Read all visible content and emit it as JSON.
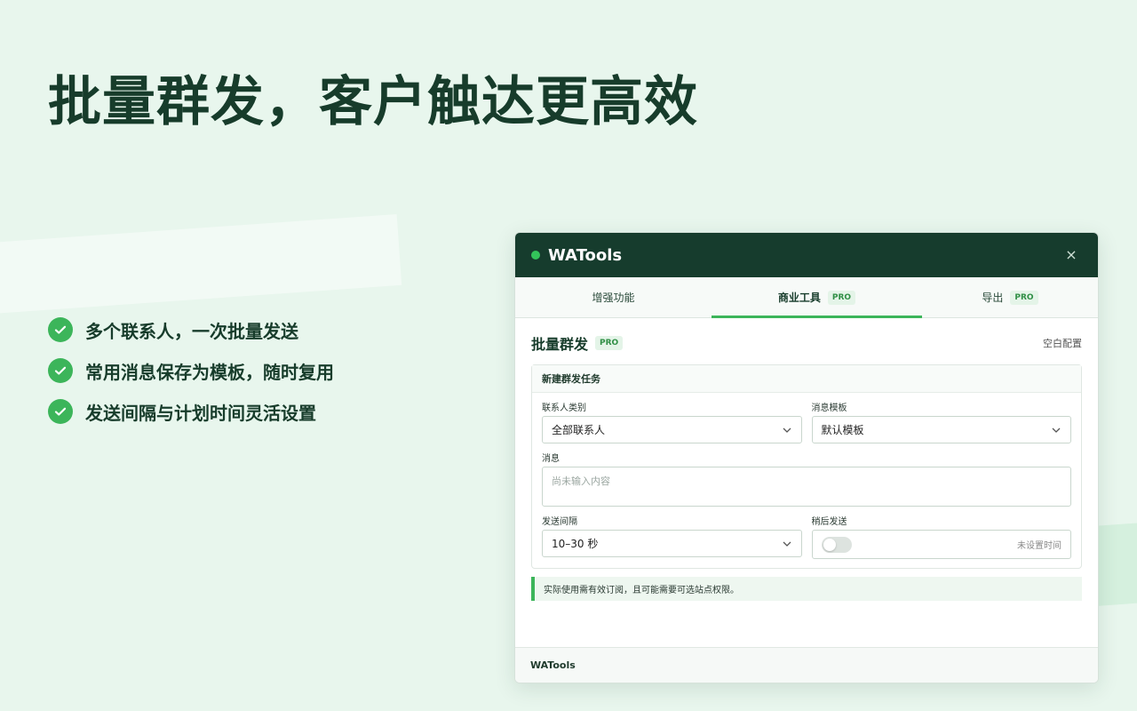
{
  "hero": {
    "title": "批量群发，客户触达更高效"
  },
  "features": [
    "多个联系人，一次批量发送",
    "常用消息保存为模板，随时复用",
    "发送间隔与计划时间灵活设置"
  ],
  "panel": {
    "app_title": "WATools",
    "close": "×",
    "tabs": [
      {
        "label": "增强功能",
        "pro": false
      },
      {
        "label": "商业工具",
        "pro": true,
        "active": true
      },
      {
        "label": "导出",
        "pro": true
      }
    ],
    "pro_badge": "PRO",
    "section_title": "批量群发",
    "section_link": "空白配置",
    "card_title": "新建群发任务",
    "contact_type": {
      "label": "联系人类别",
      "value": "全部联系人"
    },
    "template": {
      "label": "消息模板",
      "value": "默认模板"
    },
    "message": {
      "label": "消息",
      "placeholder": "尚未输入内容"
    },
    "interval": {
      "label": "发送间隔",
      "value": "10–30 秒"
    },
    "schedule": {
      "label": "稍后发送",
      "hint": "未设置时间",
      "enabled": false
    },
    "notice": "实际使用需有效订阅，且可能需要可选站点权限。",
    "footer": "WATools"
  },
  "colors": {
    "header": "#163c2d",
    "accent": "#3cb55a",
    "background": "#e8f6ed"
  }
}
